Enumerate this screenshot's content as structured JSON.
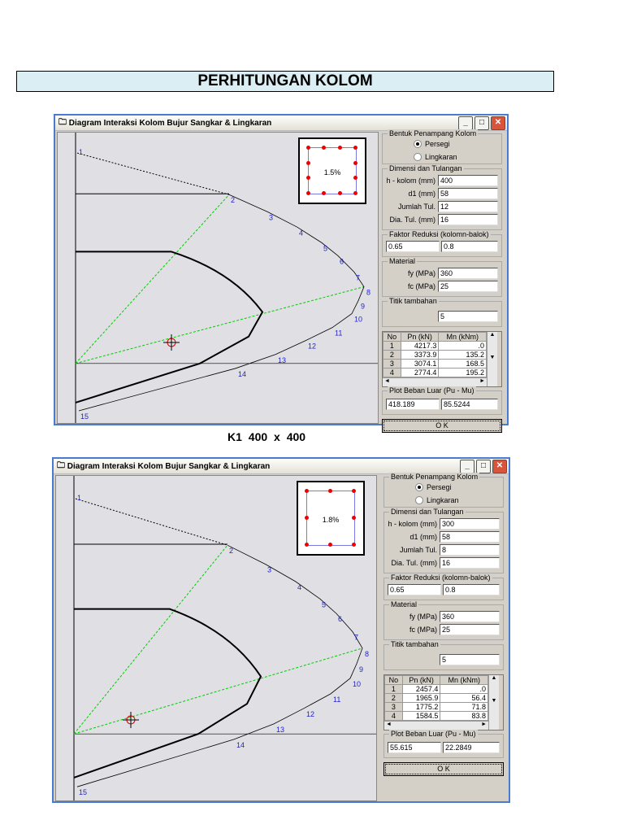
{
  "page": {
    "title": "PERHITUNGAN KOLOM",
    "caption": "K1   400  x  400"
  },
  "windows": [
    {
      "title": "Diagram Interaksi Kolom Bujur Sangkar & Lingkaran",
      "ratio": "1.5%",
      "bars": 12,
      "shape_group": "Bentuk Penampang Kolom",
      "opt1": "Persegi",
      "opt2": "Lingkaran",
      "selected": "Persegi",
      "dim_group": "Dimensi dan Tulangan",
      "h_label": "h - kolom (mm)",
      "h": "400",
      "d1_label": "d1 (mm)",
      "d1": "58",
      "n_label": "Jumlah Tul.",
      "n": "12",
      "dia_label": "Dia. Tul. (mm)",
      "dia": "16",
      "phi_group": "Faktor Reduksi (kolomn-balok)",
      "phi1": "0.65",
      "phi2": "0.8",
      "mat_group": "Material",
      "fy_label": "fy (MPa)",
      "fy": "360",
      "fc_label": "fc (MPa)",
      "fc": "25",
      "tt_group": "Titik tambahan",
      "tt": "5",
      "table": {
        "headers": [
          "No",
          "Pn (kN)",
          "Mn (kNm)"
        ],
        "rows": [
          [
            "1",
            "4217.3",
            ".0"
          ],
          [
            "2",
            "3373.9",
            "135.2"
          ],
          [
            "3",
            "3074.1",
            "168.5"
          ],
          [
            "4",
            "2774.4",
            "195.2"
          ]
        ]
      },
      "plot_group": "Plot Beban Luar (Pu - Mu)",
      "pu": "418.189",
      "mu": "85.5244",
      "ok": "O K",
      "point_labels": [
        "1",
        "2",
        "3",
        "4",
        "5",
        "6",
        "7",
        "8",
        "9",
        "10",
        "11",
        "12",
        "13",
        "14",
        "15"
      ]
    },
    {
      "title": "Diagram Interaksi Kolom Bujur Sangkar & Lingkaran",
      "ratio": "1.8%",
      "bars": 8,
      "shape_group": "Bentuk Penampang Kolom",
      "opt1": "Persegi",
      "opt2": "Lingkaran",
      "selected": "Persegi",
      "dim_group": "Dimensi dan Tulangan",
      "h_label": "h - kolom (mm)",
      "h": "300",
      "d1_label": "d1 (mm)",
      "d1": "58",
      "n_label": "Jumlah Tul.",
      "n": "8",
      "dia_label": "Dia. Tul. (mm)",
      "dia": "16",
      "phi_group": "Faktor Reduksi (kolomn-balok)",
      "phi1": "0.65",
      "phi2": "0.8",
      "mat_group": "Material",
      "fy_label": "fy (MPa)",
      "fy": "360",
      "fc_label": "fc (MPa)",
      "fc": "25",
      "tt_group": "Titik tambahan",
      "tt": "5",
      "table": {
        "headers": [
          "No",
          "Pn (kN)",
          "Mn (kNm)"
        ],
        "rows": [
          [
            "1",
            "2457.4",
            ".0"
          ],
          [
            "2",
            "1965.9",
            "56.4"
          ],
          [
            "3",
            "1775.2",
            "71.8"
          ],
          [
            "4",
            "1584.5",
            "83.8"
          ]
        ]
      },
      "plot_group": "Plot Beban Luar (Pu - Mu)",
      "pu": "55.615",
      "mu": "22.2849",
      "ok": "O K",
      "point_labels": [
        "1",
        "2",
        "3",
        "4",
        "5",
        "6",
        "7",
        "8",
        "9",
        "10",
        "11",
        "12",
        "13",
        "14",
        "15"
      ]
    }
  ]
}
